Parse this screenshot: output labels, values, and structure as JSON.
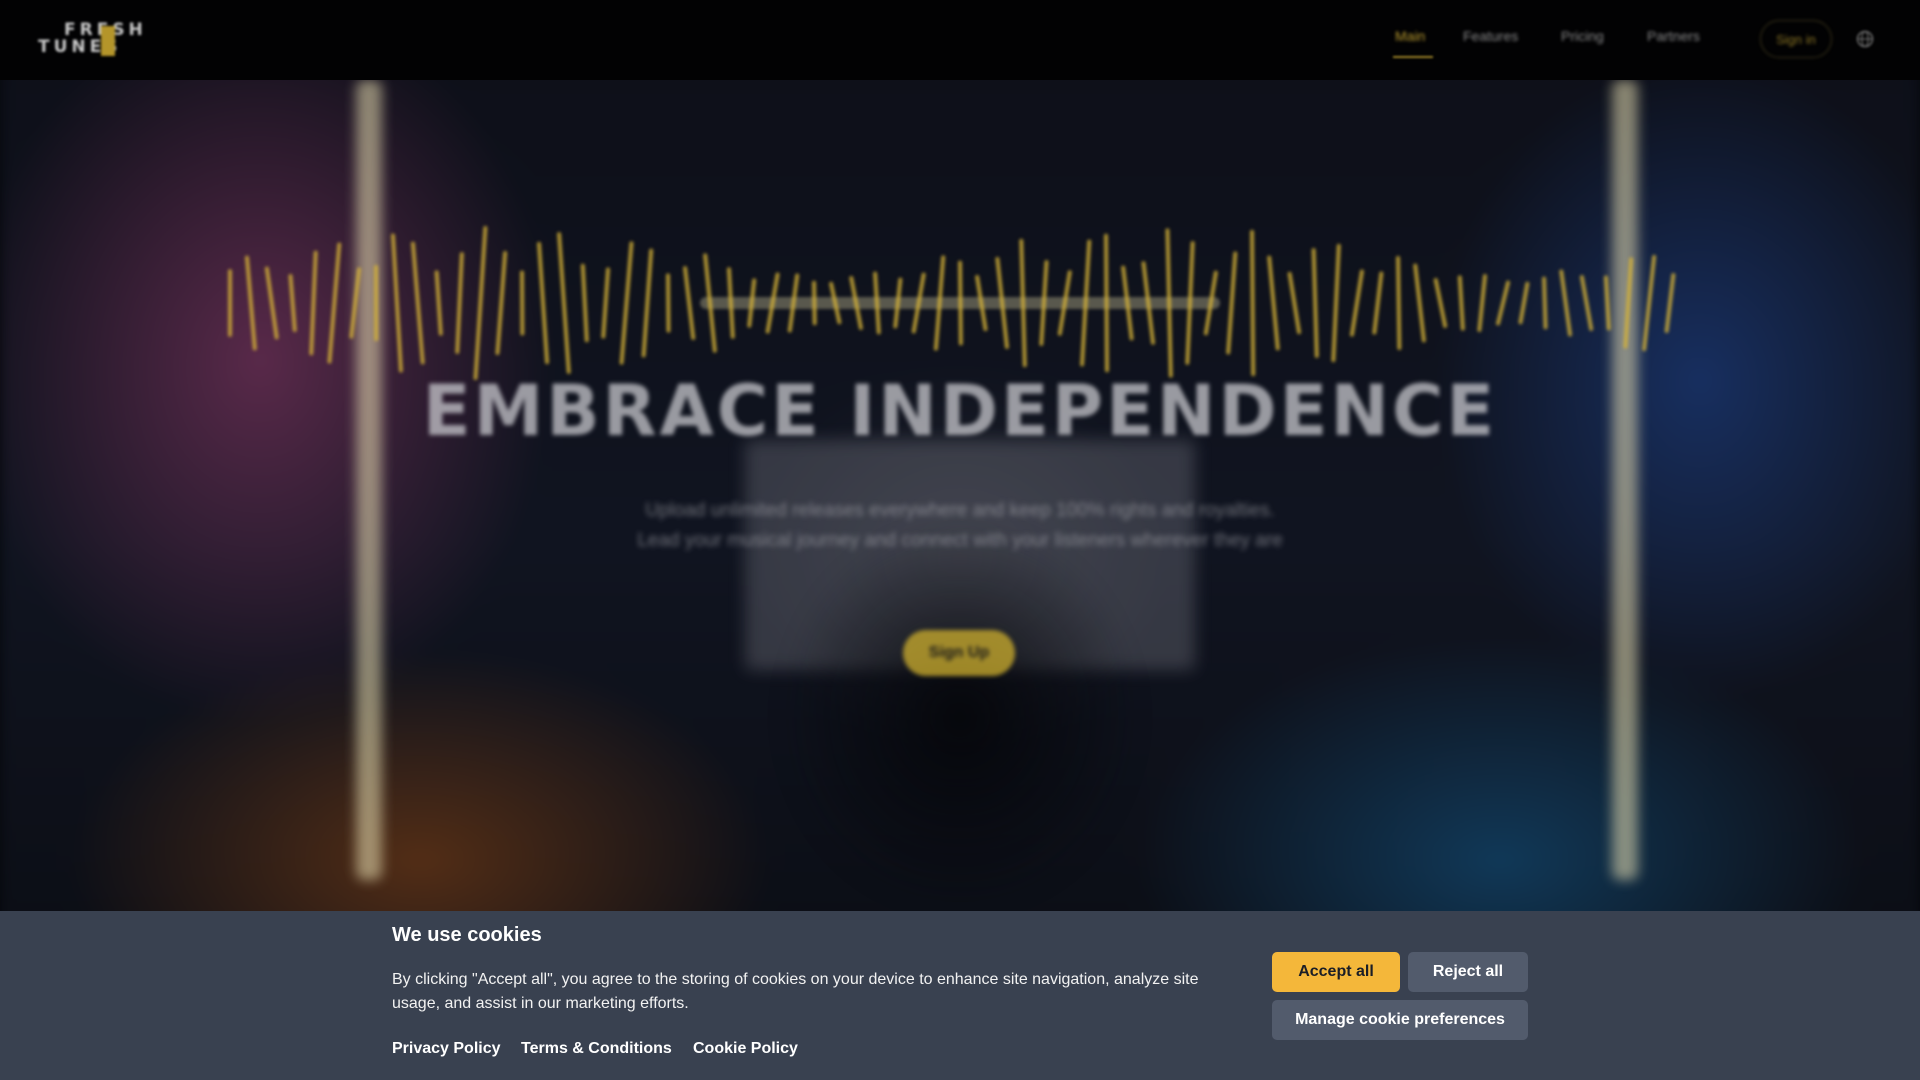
{
  "header": {
    "logo_line1": "FRESH",
    "logo_line2": "TUNES",
    "nav": [
      {
        "label": "Main",
        "active": true
      },
      {
        "label": "Features",
        "active": false
      },
      {
        "label": "Pricing",
        "active": false
      },
      {
        "label": "Partners",
        "active": false
      }
    ],
    "signin_label": "Sign in",
    "language_icon": "globe-icon"
  },
  "hero": {
    "title": "EMBRACE INDEPENDENCE",
    "subtitle": "Upload unlimited releases everywhere and keep 100% rights and royalties. Lead your musical journey and connect with your listeners wherever they are",
    "cta_label": "Sign Up"
  },
  "cookie_banner": {
    "title": "We use cookies",
    "text": "By clicking \"Accept all\", you agree to the storing of cookies on your device to enhance site navigation, analyze site usage, and assist in our marketing efforts.",
    "links": {
      "privacy": "Privacy Policy",
      "terms": "Terms & Conditions",
      "cookie": "Cookie Policy"
    },
    "buttons": {
      "accept": "Accept all",
      "reject": "Reject all",
      "manage": "Manage cookie preferences"
    }
  },
  "colors": {
    "accent": "#f4b73a",
    "banner_bg": "#394150",
    "secondary_button": "#525b6c",
    "waveform": "#d6b338",
    "header_bg": "#020203"
  }
}
